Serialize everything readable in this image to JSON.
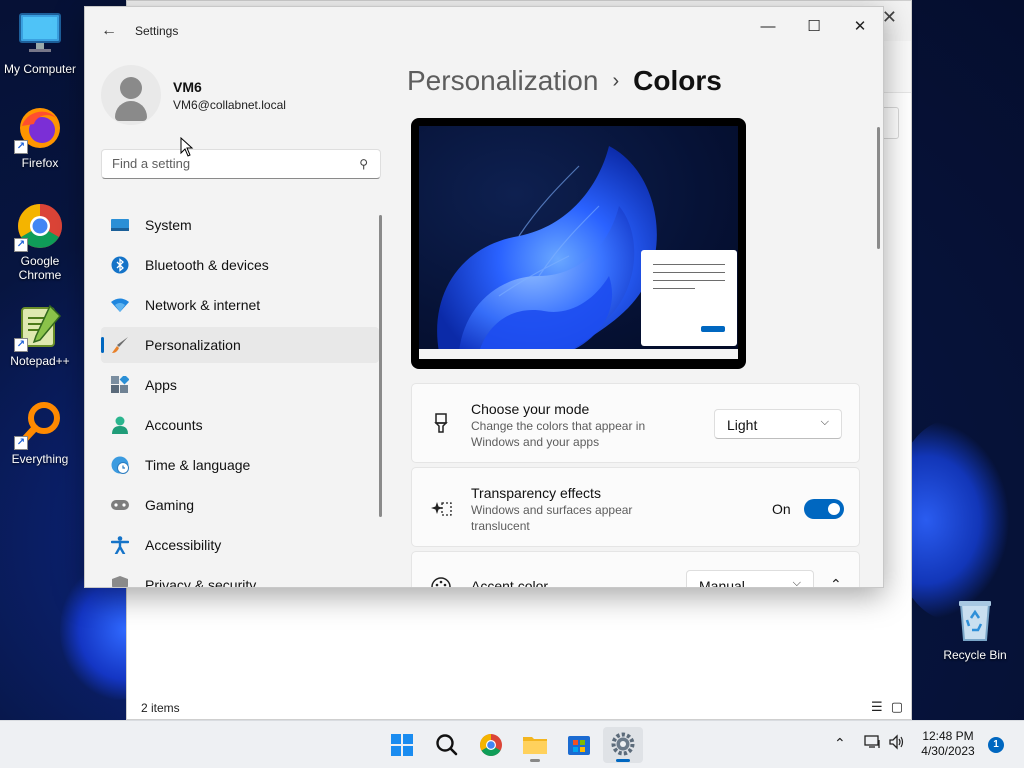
{
  "desktop": {
    "icons": [
      {
        "name": "my-computer",
        "label": "My Computer"
      },
      {
        "name": "firefox",
        "label": "Firefox"
      },
      {
        "name": "google-chrome",
        "label": "Google Chrome"
      },
      {
        "name": "notepad-plus-plus",
        "label": "Notepad++"
      },
      {
        "name": "everything",
        "label": "Everything"
      },
      {
        "name": "recycle-bin",
        "label": "Recycle Bin"
      }
    ]
  },
  "explorer": {
    "status": "2 items",
    "close_glyph": "✕",
    "view_details_glyph": "☰",
    "view_tiles_glyph": "▢"
  },
  "settings": {
    "title": "Settings",
    "back_glyph": "←",
    "window_controls": {
      "minimize": "—",
      "maximize": "☐",
      "close": "✕"
    },
    "profile": {
      "name": "VM6",
      "email": "VM6@collabnet.local"
    },
    "search": {
      "placeholder": "Find a setting",
      "icon_glyph": "⚲"
    },
    "nav": [
      {
        "label": "System",
        "icon": "system-icon"
      },
      {
        "label": "Bluetooth & devices",
        "icon": "bluetooth-icon"
      },
      {
        "label": "Network & internet",
        "icon": "wifi-icon"
      },
      {
        "label": "Personalization",
        "icon": "brush-icon",
        "selected": true
      },
      {
        "label": "Apps",
        "icon": "apps-icon"
      },
      {
        "label": "Accounts",
        "icon": "accounts-icon"
      },
      {
        "label": "Time & language",
        "icon": "time-language-icon"
      },
      {
        "label": "Gaming",
        "icon": "gaming-icon"
      },
      {
        "label": "Accessibility",
        "icon": "accessibility-icon"
      },
      {
        "label": "Privacy & security",
        "icon": "privacy-shield-icon"
      }
    ],
    "breadcrumb": {
      "parent": "Personalization",
      "separator": "›",
      "current": "Colors"
    },
    "cards": {
      "mode": {
        "title": "Choose your mode",
        "desc": "Change the colors that appear in Windows and your apps",
        "value": "Light",
        "chevron": "⌵"
      },
      "transparency": {
        "title": "Transparency effects",
        "desc": "Windows and surfaces appear translucent",
        "state_label": "On",
        "enabled": true
      },
      "accent": {
        "title": "Accent color",
        "value": "Manual",
        "chevron": "⌵",
        "expand_glyph": "⌃"
      }
    },
    "accent_color": "#0067c0"
  },
  "taskbar": {
    "items": [
      {
        "name": "start-button",
        "icon": "windows-logo-icon"
      },
      {
        "name": "search-button",
        "icon": "search-icon"
      },
      {
        "name": "chrome-button",
        "icon": "chrome-icon"
      },
      {
        "name": "file-explorer-button",
        "icon": "folder-icon",
        "running": true
      },
      {
        "name": "store-button",
        "icon": "store-icon"
      },
      {
        "name": "settings-button",
        "icon": "gear-icon",
        "active": true
      }
    ],
    "tray": {
      "chevron": "⌃",
      "time": "12:48 PM",
      "date": "4/30/2023",
      "notifications": "1"
    }
  }
}
